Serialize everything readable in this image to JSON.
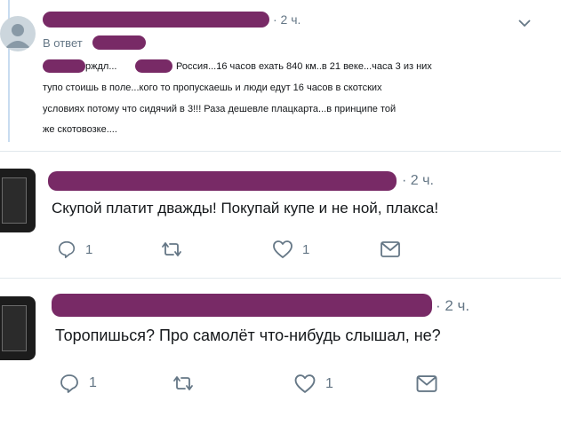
{
  "tweets": [
    {
      "time": "· 2 ч.",
      "reply_label": "В ответ",
      "text_lines": [
        "Россия...16 часов ехать 840 км..в 21 веке...часа 3 из них",
        "тупо стоишь в поле...кого то пропускаешь и люди едут 16 часов в скотских",
        "условиях потому что сидячий в 3!!! Раза дешевле плацкарта...в принципе той",
        "же скотовозке...."
      ],
      "text_fragment": "рждл..."
    },
    {
      "time": "· 2 ч.",
      "text": "Скупой платит дважды! Покупай купе и не ной, плакса!",
      "reply_count": "1",
      "like_count": "1"
    },
    {
      "time": "· 2 ч.",
      "text": "Торопишься? Про самолёт что-нибудь слышал, не?",
      "reply_count": "1",
      "like_count": "1"
    }
  ],
  "icons": {
    "reply": "reply-icon",
    "retweet": "retweet-icon",
    "like": "heart-icon",
    "dm": "envelope-icon",
    "more": "chevron-down-icon"
  },
  "colors": {
    "icon": "#657786",
    "redaction": "#6e1a5a",
    "thread_line": "#c9dcf0"
  }
}
